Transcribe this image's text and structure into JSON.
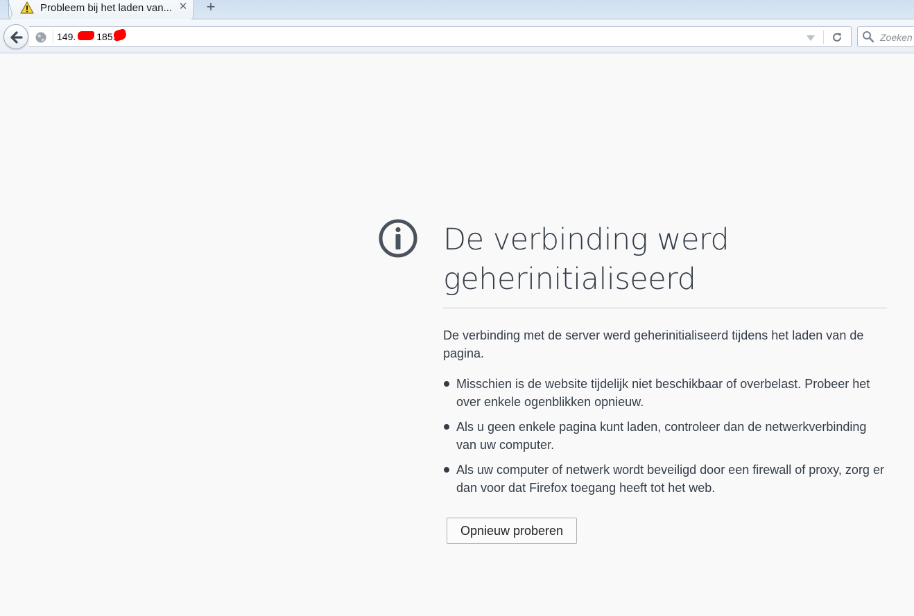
{
  "tab": {
    "title": "Probleem bij het laden van...",
    "close_glyph": "✕",
    "new_tab_glyph": "+",
    "icon": "warning-icon"
  },
  "navbar": {
    "url_visible_parts": [
      "149.",
      "185."
    ],
    "search_placeholder": "Zoeken",
    "icons": [
      "back-arrow-icon",
      "globe-icon",
      "dropdown-icon",
      "reload-icon",
      "search-icon"
    ]
  },
  "error": {
    "title_line1": "De verbinding werd",
    "title_line2": "geherinitialiseerd",
    "description": "De verbinding met de server werd geherinitialiseerd tijdens het laden van de pagina.",
    "bullets": [
      "Misschien is de website tijdelijk niet beschikbaar of overbelast. Probeer het over enkele ogenblikken opnieuw.",
      "Als u geen enkele pagina kunt laden, controleer dan de netwerkverbinding van uw computer.",
      "Als uw computer of netwerk wordt beveiligd door een firewall of proxy, zorg er dan voor dat Firefox toegang heeft tot het web."
    ],
    "retry_label": "Opnieuw proberen",
    "icon": "info-icon"
  },
  "colors": {
    "text": "#333c47",
    "page_background": "#f9f9fa",
    "redaction": "#ff0000"
  }
}
